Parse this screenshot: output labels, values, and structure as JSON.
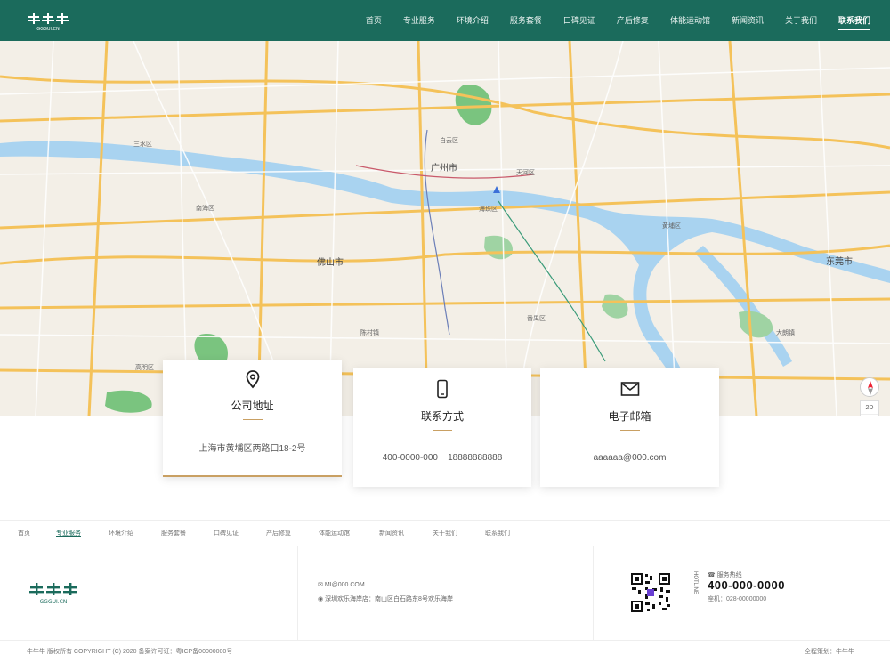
{
  "header": {
    "logo_text": "牛牛牛",
    "logo_sub": "GGGUI.CN",
    "nav": [
      {
        "label": "首页"
      },
      {
        "label": "专业服务"
      },
      {
        "label": "环境介绍"
      },
      {
        "label": "服务套餐"
      },
      {
        "label": "口碑见证"
      },
      {
        "label": "产后修复"
      },
      {
        "label": "体能运动馆"
      },
      {
        "label": "新闻资讯"
      },
      {
        "label": "关于我们"
      },
      {
        "label": "联系我们",
        "active": true
      }
    ]
  },
  "map": {
    "labels": {
      "guangzhou": "广州市",
      "foshan": "佛山市",
      "dongguan": "东莞市",
      "haizhu": "海珠区",
      "baiyun": "白云区",
      "tianhe": "天河区",
      "huangpu": "黄埔区",
      "nanhai": "南海区",
      "panyu": "番禺区",
      "sanshui": "三水区",
      "gaoming": "高明区",
      "chencun": "陈村镇",
      "dalang": "大朗镇"
    },
    "control_2d": "2D",
    "control_plus": "+",
    "control_minus": "−",
    "compass_icon": "compass-icon"
  },
  "contact": {
    "address": {
      "title": "公司地址",
      "value": "上海市黄埔区两路口18-2号",
      "icon": "location-pin-icon"
    },
    "phone": {
      "title": "联系方式",
      "value": "400-0000-000    18888888888",
      "icon": "mobile-phone-icon"
    },
    "email": {
      "title": "电子邮箱",
      "value": "aaaaaa@000.com",
      "icon": "envelope-icon"
    }
  },
  "footer_nav": [
    {
      "label": "首页"
    },
    {
      "label": "专业服务",
      "active": true
    },
    {
      "label": "环境介绍"
    },
    {
      "label": "服务套餐"
    },
    {
      "label": "口碑见证"
    },
    {
      "label": "产后修复"
    },
    {
      "label": "体能运动馆"
    },
    {
      "label": "新闻资讯"
    },
    {
      "label": "关于我们"
    },
    {
      "label": "联系我们"
    }
  ],
  "footer": {
    "mail": "MI@000.COM",
    "address": "深圳欢乐海岸店：南山区白石路东8号欢乐海岸",
    "hotline_vertical": "HOTLINE",
    "hotline_label": "服务热线",
    "hotline": "400-000-0000",
    "fax": "座机：028-00000000",
    "copyright": "牛牛牛 版权所有 COPYRIGHT (C) 2020 备案许可证：粤ICP备00000000号",
    "credit": "全程策划：牛牛牛"
  },
  "colors": {
    "brand": "#1b6b5c",
    "accent": "#c9a063"
  }
}
